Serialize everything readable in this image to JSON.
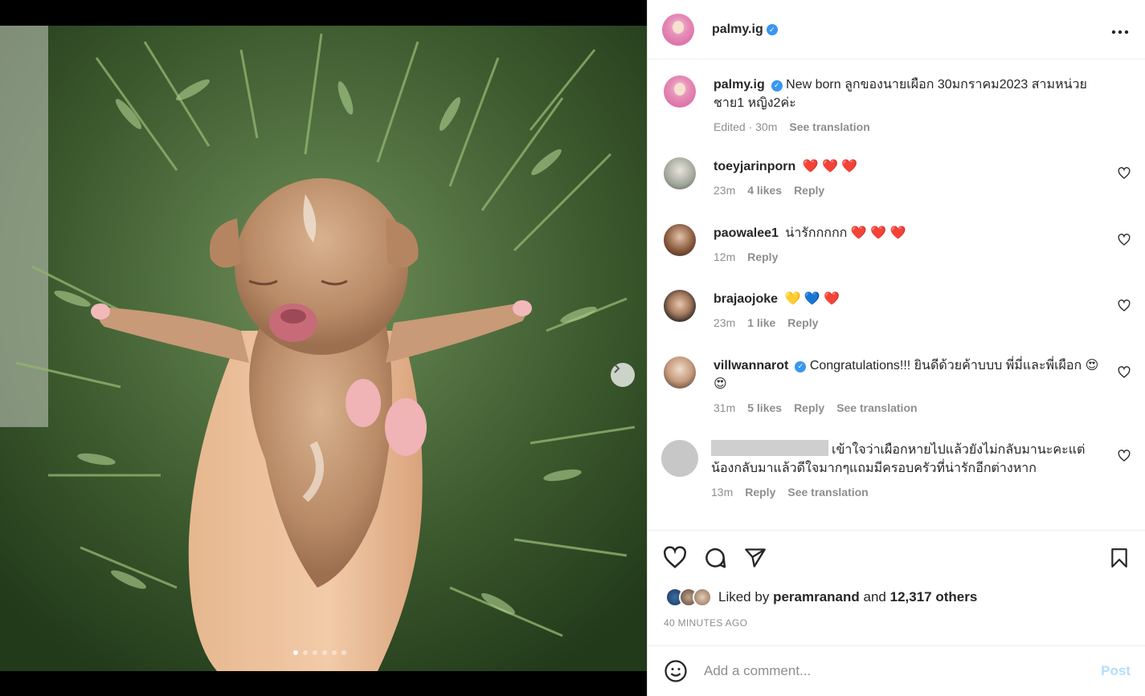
{
  "post": {
    "author": "palmy.ig",
    "caption": "New born ลูกของนายเผือก 30มกราคม2023 สามหน่วย ชาย1 หญิง2ค่ะ",
    "caption_meta": "Edited · 30m",
    "see_translation": "See translation",
    "carousel": {
      "slides": 6,
      "active_index": 0
    }
  },
  "comments": [
    {
      "user": "toeyjarinporn",
      "verified": false,
      "text": "❤️ ❤️ ❤️",
      "time": "23m",
      "likes": "4 likes",
      "reply": "Reply",
      "translate": ""
    },
    {
      "user": "paowalee1",
      "verified": false,
      "text": "น่ารักกกกก ❤️ ❤️ ❤️",
      "time": "12m",
      "likes": "",
      "reply": "Reply",
      "translate": ""
    },
    {
      "user": "brajaojoke",
      "verified": false,
      "text": "💛 💙 ❤️",
      "time": "23m",
      "likes": "1 like",
      "reply": "Reply",
      "translate": ""
    },
    {
      "user": "villwannarot",
      "verified": true,
      "text": "Congratulations!!! ยินดีด้วยค้าบบบ พี่มี่และพี่เผือก 😍 😍",
      "time": "31m",
      "likes": "5 likes",
      "reply": "Reply",
      "translate": "See translation"
    },
    {
      "user": "",
      "verified": false,
      "text": "เข้าใจว่าเผือกหายไปแล้วยังไม่กลับมานะคะแต่น้องกลับมาแล้วดีใจมากๆแถมมีครอบครัวที่น่ารักอีกต่างหาก",
      "time": "13m",
      "likes": "",
      "reply": "Reply",
      "translate": "See translation"
    }
  ],
  "likes": {
    "prefix": "Liked by",
    "user": "peramranand",
    "and": "and",
    "count": "12,317 others"
  },
  "timestamp": "40 MINUTES AGO",
  "comment_box": {
    "placeholder": "Add a comment...",
    "post_label": "Post"
  },
  "icons": {
    "more": "more-horizontal-icon",
    "like": "heart-icon",
    "comment": "comment-bubble-icon",
    "share": "paper-plane-icon",
    "save": "bookmark-icon",
    "emoji": "emoji-smile-icon",
    "verified": "verified-badge-icon",
    "next": "chevron-right-icon"
  },
  "colors": {
    "verified": "#3897f0",
    "post_disabled": "#b2dffc",
    "heart_red": "#ed4956",
    "muted": "#8e8e8e"
  }
}
